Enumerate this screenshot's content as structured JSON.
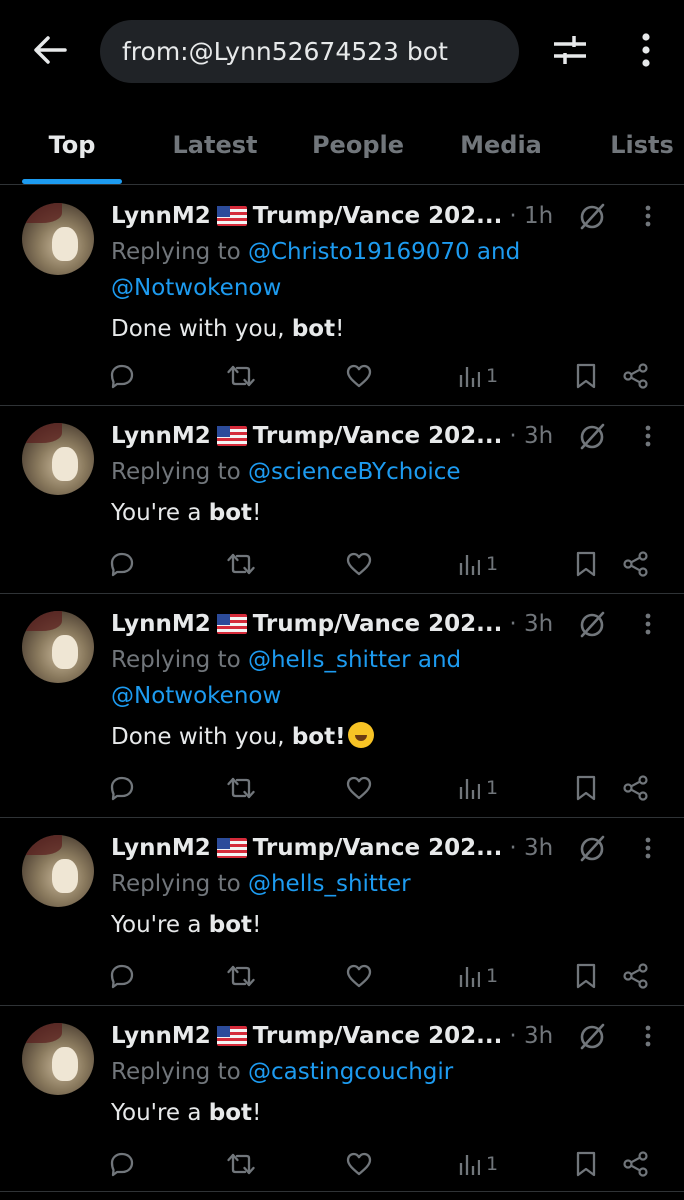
{
  "search": {
    "query": "from:@Lynn52674523 bot"
  },
  "icons": {
    "back": "arrow-left-icon",
    "filter": "sliders-icon",
    "more": "vertical-ellipsis-icon",
    "grok": "grok-slash-circle-icon",
    "reply": "speech-bubble-icon",
    "retweet": "retweet-icon",
    "like": "heart-icon",
    "views": "bar-chart-icon",
    "bookmark": "bookmark-icon",
    "share": "share-icon"
  },
  "colors": {
    "accent": "#1d9bf0",
    "muted": "#71767b",
    "text": "#e7e9ea",
    "divider": "#2f3336",
    "background": "#000000"
  },
  "tabs": [
    {
      "label": "Top",
      "active": true
    },
    {
      "label": "Latest",
      "active": false
    },
    {
      "label": "People",
      "active": false
    },
    {
      "label": "Media",
      "active": false
    },
    {
      "label": "Lists",
      "active": false
    }
  ],
  "tweets": [
    {
      "name_a": "LynnM2",
      "name_b": "Trump/Vance 202...",
      "time": "· 1h",
      "replying_prefix": "Replying to",
      "mention_1": "@Christo19169070",
      "joiner": "and",
      "mention_2": "@Notwokenow",
      "text_pre": "Done with you,",
      "text_bold": "bot",
      "text_post": "!",
      "has_emoji": false,
      "views": "1"
    },
    {
      "name_a": "LynnM2",
      "name_b": "Trump/Vance 202...",
      "time": "· 3h",
      "replying_prefix": "Replying to",
      "mention_1": "@scienceBYchoice",
      "joiner": "",
      "mention_2": "",
      "text_pre": "You're a",
      "text_bold": "bot",
      "text_post": "!",
      "has_emoji": false,
      "views": "1"
    },
    {
      "name_a": "LynnM2",
      "name_b": "Trump/Vance 202...",
      "time": "· 3h",
      "replying_prefix": "Replying to",
      "mention_1": "@hells_shitter",
      "joiner": "and",
      "mention_2": "@Notwokenow",
      "text_pre": "Done with you,",
      "text_bold": "bot!",
      "text_post": "",
      "has_emoji": true,
      "views": "1"
    },
    {
      "name_a": "LynnM2",
      "name_b": "Trump/Vance 202...",
      "time": "· 3h",
      "replying_prefix": "Replying to",
      "mention_1": "@hells_shitter",
      "joiner": "",
      "mention_2": "",
      "text_pre": "You're a",
      "text_bold": "bot",
      "text_post": "!",
      "has_emoji": false,
      "views": "1"
    },
    {
      "name_a": "LynnM2",
      "name_b": "Trump/Vance 202...",
      "time": "· 3h",
      "replying_prefix": "Replying to",
      "mention_1": "@castingcouchgir",
      "joiner": "",
      "mention_2": "",
      "text_pre": "You're a",
      "text_bold": "bot",
      "text_post": "!",
      "has_emoji": false,
      "views": "1"
    }
  ]
}
